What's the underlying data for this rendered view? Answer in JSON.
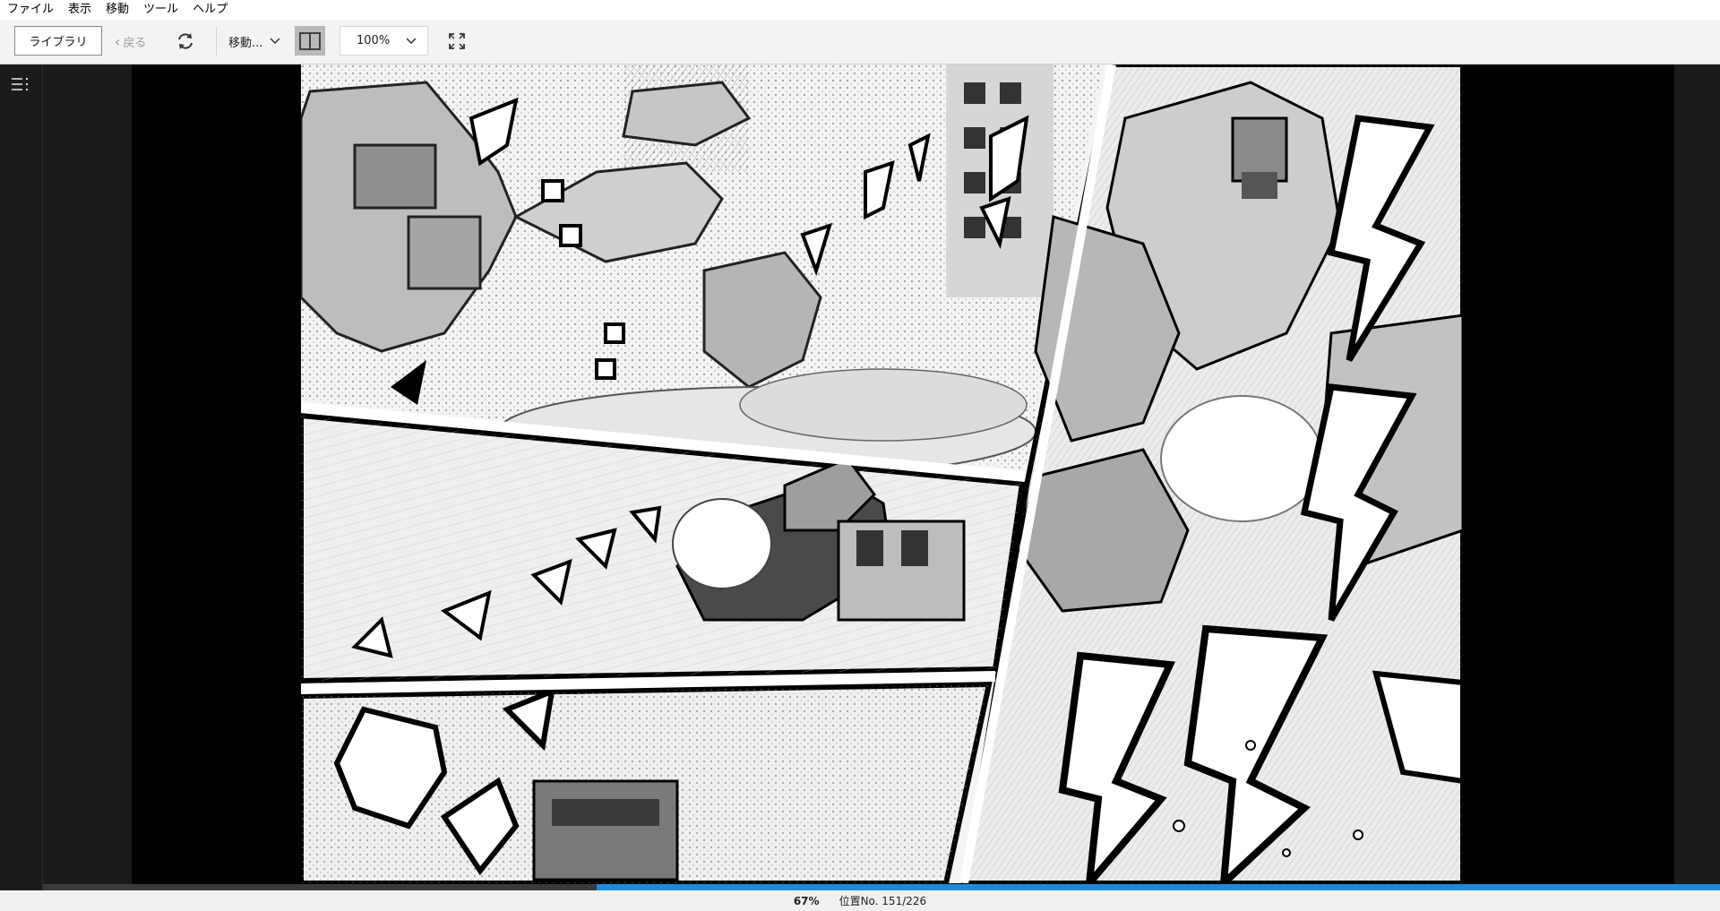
{
  "menu": {
    "file": "ファイル",
    "view": "表示",
    "go": "移動",
    "tools": "ツール",
    "help": "ヘルプ"
  },
  "toolbar": {
    "library_label": "ライブラリ",
    "back_label": "戻る",
    "move_label": "移動...",
    "zoom_value": "100%"
  },
  "icons": {
    "refresh": "refresh-icon",
    "spread": "two-page-spread-icon",
    "fullscreen": "fullscreen-icon",
    "toc": "table-of-contents-icon"
  },
  "status": {
    "percent": "67%",
    "location": "位置No. 151/226",
    "progress_fraction": 0.67
  },
  "colors": {
    "accent": "#1e8ad6",
    "spread_active": "#b9b9b9"
  }
}
